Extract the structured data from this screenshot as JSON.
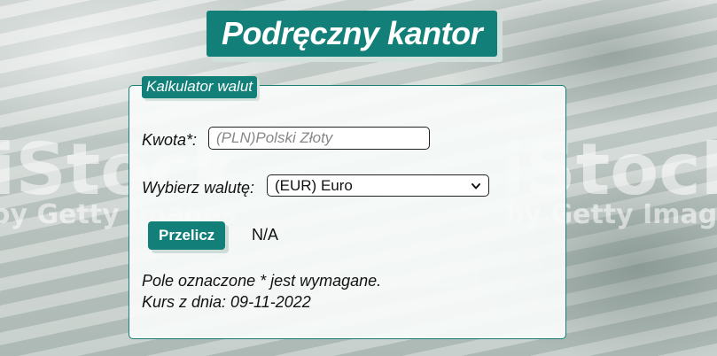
{
  "app": {
    "title": "Podręczny kantor"
  },
  "calculator": {
    "legend": "Kalkulator walut",
    "amount_label": "Kwota*:",
    "amount_placeholder": "(PLN)Polski Złoty",
    "currency_label": "Wybierz walutę:",
    "currency_selected": "(EUR) Euro",
    "convert_button": "Przelicz",
    "result": "N/A",
    "required_note": "Pole oznaczone * jest wymagane.",
    "rate_date": "Kurs z dnia: 09-11-2022"
  },
  "background": {
    "watermark_main": "iStock",
    "watermark_sub": "by Getty Images"
  },
  "colors": {
    "accent": "#128078",
    "text": "#111111"
  }
}
